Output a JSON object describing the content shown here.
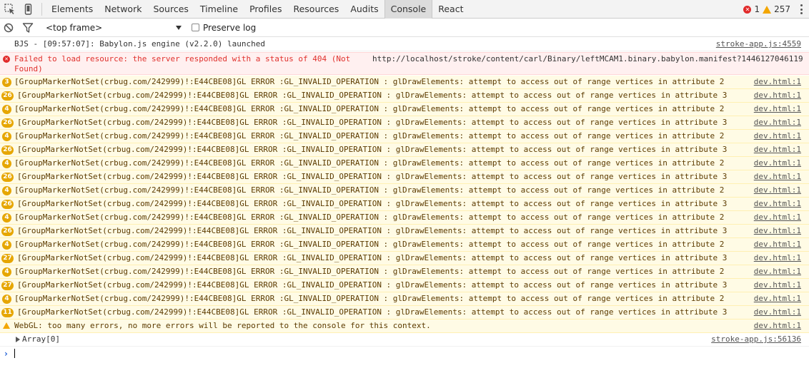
{
  "toolbar": {
    "inspect_icon": "inspect-element-icon",
    "device_icon": "device-mode-icon",
    "tabs": [
      {
        "label": "Elements"
      },
      {
        "label": "Network"
      },
      {
        "label": "Sources"
      },
      {
        "label": "Timeline"
      },
      {
        "label": "Profiles"
      },
      {
        "label": "Resources"
      },
      {
        "label": "Audits"
      },
      {
        "label": "Console"
      },
      {
        "label": "React"
      }
    ],
    "active_tab": "Console",
    "error_count": "1",
    "warning_count": "257"
  },
  "filter": {
    "frame": "<top frame>",
    "preserve_log_label": "Preserve log"
  },
  "console": {
    "launch": {
      "message": "BJS - [09:57:07]: Babylon.js engine (v2.2.0) launched",
      "source": "stroke-app.js:4559"
    },
    "error": {
      "message": "Failed to load resource: the server responded with a status of 404 (Not Found)",
      "url": "http://localhost/stroke/content/carl/Binary/leftMCAM1.binary.babylon.manifest?1446127046119"
    },
    "gl_prefix": "[GroupMarkerNotSet(crbug.com/242999)!:E44CBE08]GL ERROR :GL_INVALID_OPERATION : glDrawElements: attempt to access out of range vertices in attribute ",
    "gl_rows": [
      {
        "count": "3",
        "attr": "2",
        "source": "dev.html:1"
      },
      {
        "count": "26",
        "attr": "3",
        "source": "dev.html:1"
      },
      {
        "count": "4",
        "attr": "2",
        "source": "dev.html:1"
      },
      {
        "count": "26",
        "attr": "3",
        "source": "dev.html:1"
      },
      {
        "count": "4",
        "attr": "2",
        "source": "dev.html:1"
      },
      {
        "count": "26",
        "attr": "3",
        "source": "dev.html:1"
      },
      {
        "count": "4",
        "attr": "2",
        "source": "dev.html:1"
      },
      {
        "count": "26",
        "attr": "3",
        "source": "dev.html:1"
      },
      {
        "count": "4",
        "attr": "2",
        "source": "dev.html:1"
      },
      {
        "count": "26",
        "attr": "3",
        "source": "dev.html:1"
      },
      {
        "count": "4",
        "attr": "2",
        "source": "dev.html:1"
      },
      {
        "count": "26",
        "attr": "3",
        "source": "dev.html:1"
      },
      {
        "count": "4",
        "attr": "2",
        "source": "dev.html:1"
      },
      {
        "count": "27",
        "attr": "3",
        "source": "dev.html:1"
      },
      {
        "count": "4",
        "attr": "2",
        "source": "dev.html:1"
      },
      {
        "count": "27",
        "attr": "3",
        "source": "dev.html:1"
      },
      {
        "count": "4",
        "attr": "2",
        "source": "dev.html:1"
      },
      {
        "count": "11",
        "attr": "3",
        "source": "dev.html:1"
      }
    ],
    "webgl_warning": {
      "message": "WebGL: too many errors, no more errors will be reported to the console for this context.",
      "source": "dev.html:1"
    },
    "array_row": {
      "message": "Array[0]",
      "source": "stroke-app.js:56136"
    },
    "prompt_symbol": "›"
  },
  "colors": {
    "error_text": "#e0312d",
    "error_bg": "#fff0f0",
    "warn_bg": "#fffbe5",
    "badge": "#e6a600",
    "prompt": "#2f6ad8"
  }
}
